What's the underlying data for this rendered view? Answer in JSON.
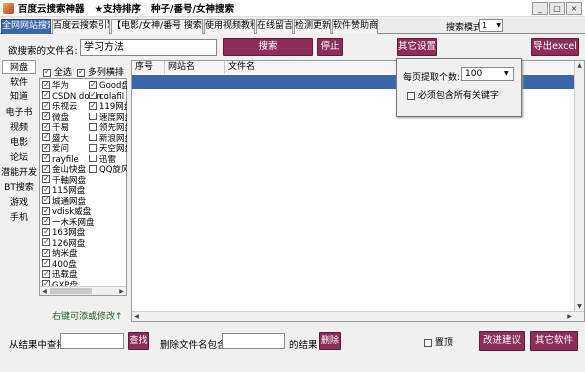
{
  "app": {
    "title": "百度云搜索神器",
    "title2": "★支持排序",
    "title3": "种子/番号/女神搜索",
    "min": "_",
    "max": "□",
    "close": "×"
  },
  "tabs": [
    "全网网站搜索",
    "百度云搜索引擎",
    "【电影/女神/番号 搜索】",
    "使用视频教程",
    "在线留言",
    "检测更新",
    "软件赞助商"
  ],
  "search_mode": {
    "label": "搜索模式",
    "value": "1"
  },
  "search": {
    "label": "欲搜索的文件名:",
    "value": "学习方法",
    "search_btn": "搜索",
    "stop_btn": "停止",
    "settings_btn": "其它设置",
    "export_btn": "导出excel"
  },
  "categories": [
    "网盘",
    "软件",
    "知道",
    "电子书",
    "视频",
    "电影",
    "论坛",
    "潜能开发",
    "BT搜索",
    "游戏",
    "手机"
  ],
  "select_all": "全选",
  "multi_sort": "多列横排",
  "sites_col1": [
    "华为",
    "CSDN down",
    "乐视云",
    "微盘",
    "千易",
    "盛大",
    "爱问",
    "rayfile",
    "金山快盘",
    "千軸网盘",
    "115网盘",
    "城通网盘",
    "vdisk威盘",
    "一木禾网盘",
    "163网盘",
    "126网盘",
    "纳米盘",
    "400盘",
    "迅载盘",
    "GXP盘"
  ],
  "sites_col2": [
    "Good盘",
    "colafil",
    "119网盘",
    "速度网盘",
    "领先网盘",
    "新浪网盘",
    "天空网盘",
    "迅雷",
    "QQ旋风"
  ],
  "sites_col2_checked": [
    true,
    true,
    true,
    false,
    false,
    false,
    false,
    false,
    false
  ],
  "right_click_hint": "右键可添或修改↑",
  "table": {
    "columns": [
      "序号",
      "网站名",
      "文件名"
    ]
  },
  "settings_popup": {
    "fetch_label": "每页提取个数:",
    "fetch_value": "100",
    "must_contain": "必须包含所有关键字"
  },
  "bottom": {
    "filter_label": "从结果中查找:",
    "filter_btn": "查找",
    "delete_label": "删除文件名包含:",
    "result_label": "的结果",
    "delete_btn": "删除",
    "ontop_label": "置顶",
    "suggest_btn": "改进建议",
    "other_btn": "其它软件"
  }
}
